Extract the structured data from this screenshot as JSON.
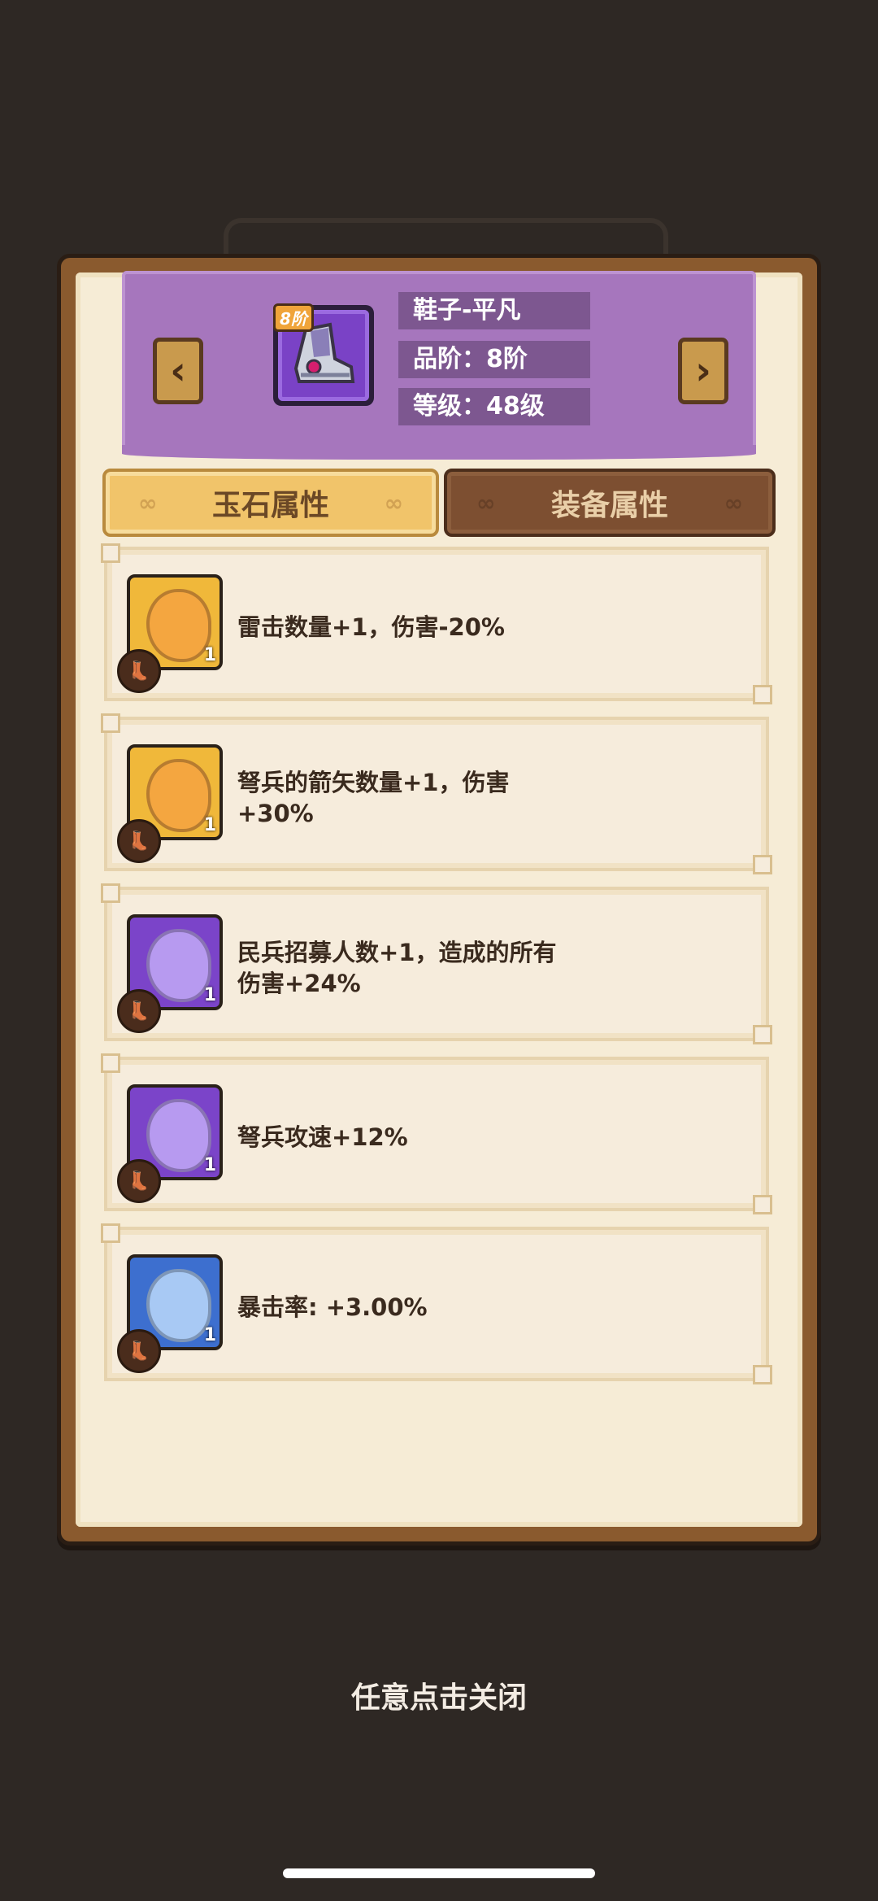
{
  "header": {
    "item_tier_badge": "8阶",
    "item_name": "鞋子-平凡",
    "grade": "品阶：8阶",
    "level": "等级：48级",
    "prev_arrow": "‹",
    "next_arrow": "›"
  },
  "tabs": [
    {
      "label": "玉石属性",
      "active": true
    },
    {
      "label": "装备属性",
      "active": false
    }
  ],
  "gems": [
    {
      "color": "#f0b83a",
      "accent": "#f4a640",
      "level": "1",
      "desc": "雷击数量+1，伤害-20%"
    },
    {
      "color": "#f0b83a",
      "accent": "#f4a640",
      "level": "1",
      "desc": "弩兵的箭矢数量+1，伤害+30%"
    },
    {
      "color": "#7b44c9",
      "accent": "#b79af0",
      "level": "1",
      "desc": "民兵招募人数+1，造成的所有伤害+24%"
    },
    {
      "color": "#7b44c9",
      "accent": "#b79af0",
      "level": "1",
      "desc": "弩兵攻速+12%"
    },
    {
      "color": "#3d6fcf",
      "accent": "#a8c9f4",
      "level": "1",
      "desc": "暴击率: +3.00%"
    }
  ],
  "footer": {
    "close_hint": "任意点击关闭"
  },
  "icons": {
    "boot": "boot-icon",
    "gem": "gem-icon"
  }
}
